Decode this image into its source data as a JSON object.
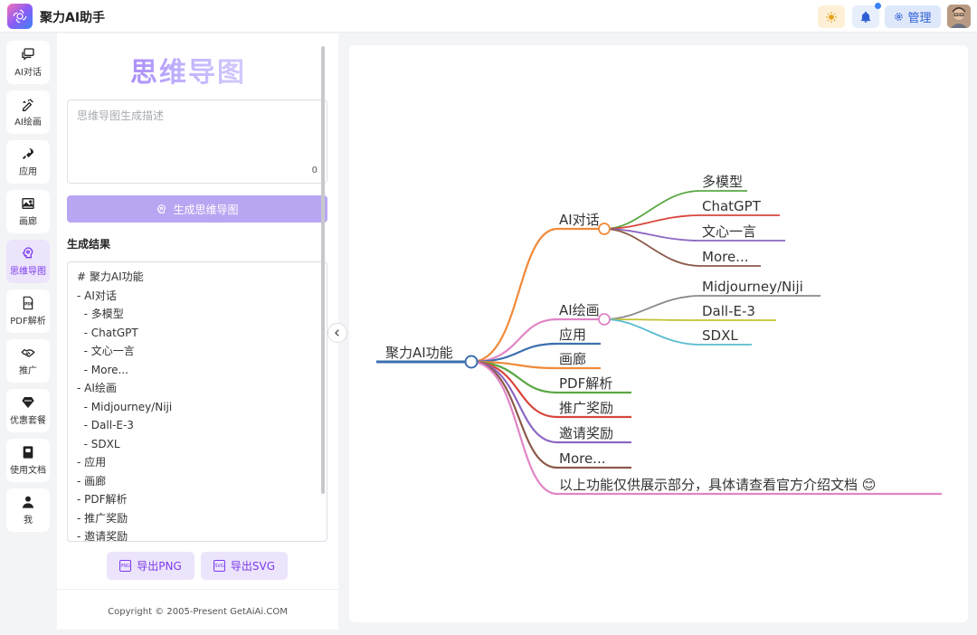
{
  "app": {
    "title": "聚力AI助手"
  },
  "header": {
    "admin_label": "管理"
  },
  "nav": {
    "items": [
      {
        "label": "AI对话",
        "icon": "chat-icon"
      },
      {
        "label": "AI绘画",
        "icon": "paint-icon"
      },
      {
        "label": "应用",
        "icon": "rocket-icon"
      },
      {
        "label": "画廊",
        "icon": "gallery-icon"
      },
      {
        "label": "思维导图",
        "icon": "mindmap-icon"
      },
      {
        "label": "PDF解析",
        "icon": "pdf-icon"
      },
      {
        "label": "推广",
        "icon": "handshake-icon"
      },
      {
        "label": "优惠套餐",
        "icon": "diamond-icon"
      },
      {
        "label": "使用文档",
        "icon": "book-icon"
      },
      {
        "label": "我",
        "icon": "user-icon"
      }
    ],
    "active": "思维导图"
  },
  "panel": {
    "title": "思维导图",
    "description_placeholder": "思维导图生成描述",
    "char_count": "0",
    "generate_label": "生成思维导图",
    "result_label": "生成结果",
    "result_lines": [
      "# 聚力AI功能",
      "- AI对话",
      "  - 多模型",
      "  - ChatGPT",
      "  - 文心一言",
      "  - More...",
      "- AI绘画",
      "  - Midjourney/Niji",
      "  - Dall-E-3",
      "  - SDXL",
      "- 应用",
      "- 画廊",
      "- PDF解析",
      "- 推广奖励",
      "- 邀请奖励"
    ],
    "export_png": "导出PNG",
    "export_svg": "导出SVG",
    "footer": "Copyright © 2005-Present GetAiAi.COM"
  },
  "mindmap": {
    "root": "聚力AI功能",
    "branches": [
      {
        "label": "AI对话",
        "color": "#ef8a3a",
        "children": [
          {
            "label": "多模型",
            "color": "#5aa843"
          },
          {
            "label": "ChatGPT",
            "color": "#d9453b"
          },
          {
            "label": "文心一言",
            "color": "#8c67c4"
          },
          {
            "label": "More...",
            "color": "#8b5a4a"
          }
        ]
      },
      {
        "label": "AI绘画",
        "color": "#e085c6",
        "children": [
          {
            "label": "Midjourney/Niji",
            "color": "#8a8a8a"
          },
          {
            "label": "Dall-E-3",
            "color": "#c2c233"
          },
          {
            "label": "SDXL",
            "color": "#5bbcd0"
          }
        ]
      },
      {
        "label": "应用",
        "color": "#3d6fb0"
      },
      {
        "label": "画廊",
        "color": "#ef8a3a"
      },
      {
        "label": "PDF解析",
        "color": "#5aa843"
      },
      {
        "label": "推广奖励",
        "color": "#d9453b"
      },
      {
        "label": "邀请奖励",
        "color": "#8c67c4"
      },
      {
        "label": "More...",
        "color": "#8b5a4a"
      },
      {
        "label": "以上功能仅供展示部分，具体请查看官方介绍文档 😊",
        "color": "#e085c6"
      }
    ]
  }
}
